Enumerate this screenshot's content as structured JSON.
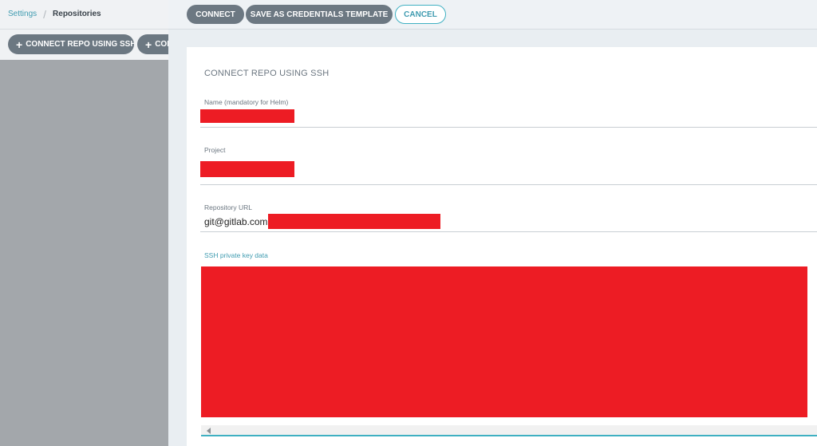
{
  "breadcrumb": {
    "parent": "Settings",
    "separator": "/",
    "current": "Repositories"
  },
  "left_toolbar": {
    "connect_ssh_label": "CONNECT REPO USING SSH",
    "connect_other_label": "CON"
  },
  "panel_toolbar": {
    "connect_label": "CONNECT",
    "save_template_label": "SAVE AS CREDENTIALS TEMPLATE",
    "cancel_label": "CANCEL"
  },
  "form": {
    "title": "CONNECT REPO USING SSH",
    "name_label": "Name (mandatory for Helm)",
    "project_label": "Project",
    "repo_url_label": "Repository URL",
    "repo_url_value": "git@gitlab.com:",
    "ssh_key_label": "SSH private key data"
  },
  "colors": {
    "accent": "#3f9bb0",
    "button": "#6c7882",
    "redaction": "#ed1c24",
    "overlay": "#a3a7ab"
  }
}
